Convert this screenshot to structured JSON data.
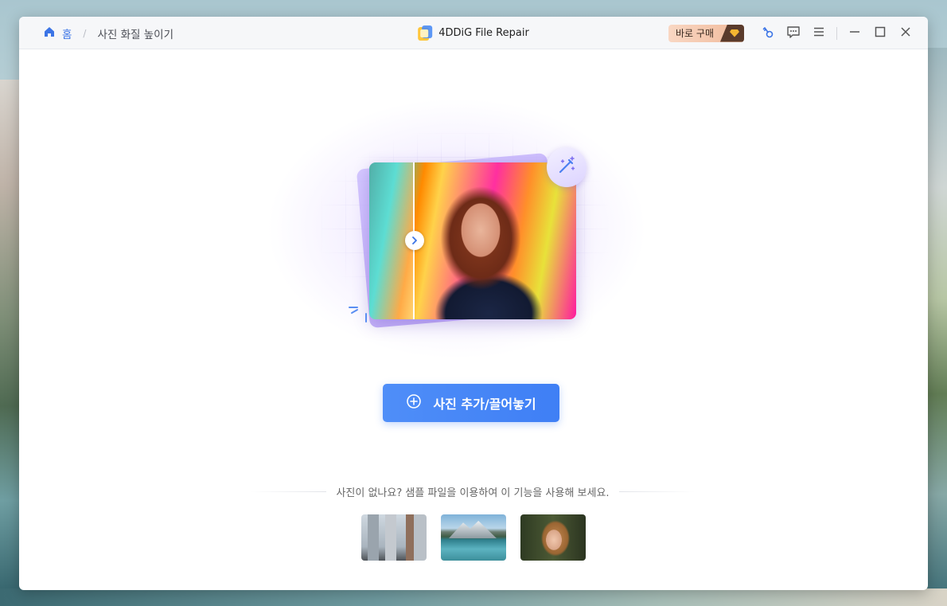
{
  "breadcrumb": {
    "home_label": "홈",
    "separator": "/",
    "current": "사진 화질 높이기"
  },
  "app": {
    "title": "4DDiG File Repair"
  },
  "toolbar": {
    "buy_label": "바로 구매"
  },
  "main": {
    "add_button_label": "사진 추가/끌어놓기",
    "sample_prompt": "사진이 없나요? 샘플 파일을 이용하여 이 기능을 사용해 보세요."
  },
  "colors": {
    "accent": "#3f7ff5",
    "buy_gradient_start": "#f9d7c3",
    "magic_purple": "#a98cf3"
  },
  "icons": {
    "home": "home-icon",
    "key": "key-icon",
    "feedback": "chat-icon",
    "menu": "menu-icon",
    "minimize": "minimize-icon",
    "maximize": "maximize-icon",
    "close": "close-icon",
    "add": "plus-circle-icon",
    "magic": "magic-wand-icon",
    "compare": "chevron-right-icon"
  }
}
